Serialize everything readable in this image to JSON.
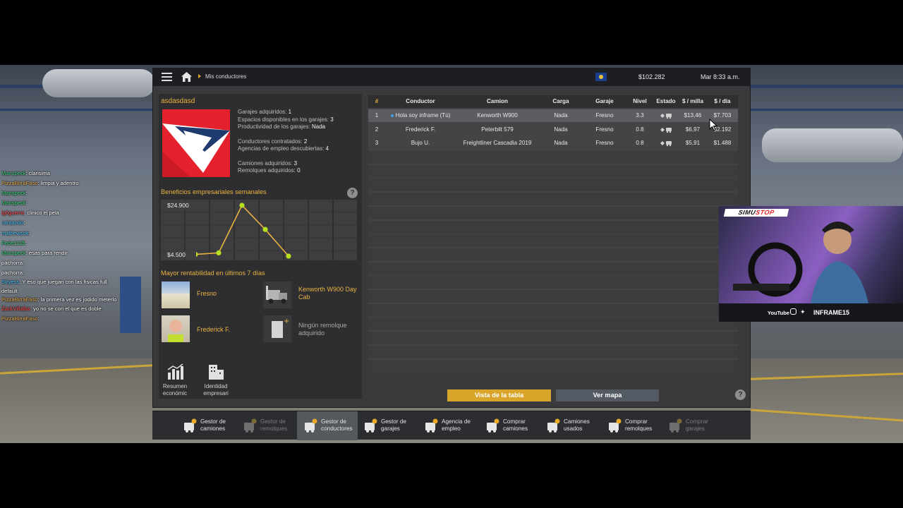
{
  "window": {
    "breadcrumb": "Mis conductores",
    "money": "$102.282",
    "clock": "Mar 8:33 a.m."
  },
  "company": {
    "name": "asdasdasd",
    "stats": [
      {
        "label": "Garajes adquiridos:",
        "value": "1"
      },
      {
        "label": "Espacios disponibles en los garajes:",
        "value": "3"
      },
      {
        "label": "Productividad de los garajes:",
        "value": "Nada"
      },
      {
        "label": "Conductores contratados:",
        "value": "2"
      },
      {
        "label": "Agencias de empleo descubiertas:",
        "value": "4"
      },
      {
        "label": "Camiones adquiridos:",
        "value": "3"
      },
      {
        "label": "Remolques adquiridos:",
        "value": "0"
      }
    ],
    "weekly_title": "Beneficios empresariales semanales",
    "best_title": "Mayor rentabilidad en últimos 7 días",
    "best": {
      "garage": "Fresno",
      "truck": "Kenworth W900 Day Cab",
      "driver": "Frederick F.",
      "trailer": "Ningún remolque adquirido"
    },
    "buttons": {
      "summary": "Resumen económic",
      "identity": "Identidad empresari"
    }
  },
  "chart_data": {
    "type": "line",
    "ytick_labels": [
      "$24.900",
      "$4.500"
    ],
    "ylim": [
      4500,
      24900
    ],
    "x": [
      1,
      2,
      3,
      4,
      5
    ],
    "values": [
      5200,
      5800,
      24900,
      15200,
      4500
    ],
    "color": "#e8b341",
    "marker_color": "#b7e01e"
  },
  "table": {
    "headers": [
      "#",
      "Conductor",
      "Camion",
      "Carga",
      "Garaje",
      "Nivel",
      "Estado",
      "$ / milla",
      "$ / día"
    ],
    "rows": [
      {
        "n": "1",
        "driver": "Hola soy inframe (Tú)",
        "truck": "Kenworth W900",
        "cargo": "Nada",
        "garage": "Fresno",
        "level": "3.3",
        "per_mile": "$13,46",
        "per_day": "$7.703"
      },
      {
        "n": "2",
        "driver": "Frederick F.",
        "truck": "Peterbilt 579",
        "cargo": "Nada",
        "garage": "Fresno",
        "level": "0.8",
        "per_mile": "$6,97",
        "per_day": "$2.192"
      },
      {
        "n": "3",
        "driver": "Bujo U.",
        "truck": "Freightliner Cascadia 2019",
        "cargo": "Nada",
        "garage": "Fresno",
        "level": "0.8",
        "per_mile": "$5,91",
        "per_day": "$1.488"
      }
    ],
    "table_view_label": "Vista de la tabla",
    "map_view_label": "Ver mapa"
  },
  "dock": [
    {
      "label": "Gestor de camiones",
      "state": "normal"
    },
    {
      "label": "Gestor de remolques",
      "state": "disabled"
    },
    {
      "label": "Gestor de conductores",
      "state": "active"
    },
    {
      "label": "Gestor de garajes",
      "state": "normal"
    },
    {
      "label": "Agencia de empleo",
      "state": "normal"
    },
    {
      "label": "Comprar camiones",
      "state": "normal"
    },
    {
      "label": "Camiones usados",
      "state": "normal"
    },
    {
      "label": "Comprar remolques",
      "state": "normal"
    },
    {
      "label": "Comprar garajes",
      "state": "disabled"
    }
  ],
  "chat": [
    {
      "user": "Manspeck",
      "text": ": clarisima",
      "color": "#37d67a"
    },
    {
      "user": "PizzaBirraFaso",
      "text": ": limpia y adentro",
      "color": "#f0b04a"
    },
    {
      "user": "Manspeck",
      "text": ":",
      "color": "#37d67a"
    },
    {
      "user": "Manspeck",
      "text": ":",
      "color": "#37d67a"
    },
    {
      "user": "lg0guerra",
      "text": ": clinico el pela",
      "color": "#ff4a4a"
    },
    {
      "user": "cantando",
      "text": ":",
      "color": "#4ac8ff"
    },
    {
      "user": "mathewsotr",
      "text": ":",
      "color": "#4ac8ff"
    },
    {
      "user": "Fede1125",
      "text": ":",
      "color": "#37d67a"
    },
    {
      "user": "Manspeck",
      "text": ": esas para rendir",
      "color": "#37d67a"
    },
    {
      "user": "pachorra",
      "text": ":",
      "color": "#ffffff"
    },
    {
      "user": "pachorra",
      "text": ":",
      "color": "#ffffff"
    },
    {
      "user": "Stryess",
      "text": ": Y eso que juegan con las fisicas full default",
      "color": "#4ac8ff"
    },
    {
      "user": "PizzaBirraFaso",
      "text": ": la primera vez es jodido meterlo",
      "color": "#f0b04a"
    },
    {
      "user": "ZackVillalba",
      "text": ": yo no se con el que es doble",
      "color": "#ff4a4a"
    },
    {
      "user": "PizzaBirraFaso",
      "text": ":",
      "color": "#f0b04a"
    }
  ],
  "webcam": {
    "brand_a": "SIMU",
    "brand_b": "STOP",
    "youtube": "YouTube",
    "handle": "INFRAME15"
  }
}
